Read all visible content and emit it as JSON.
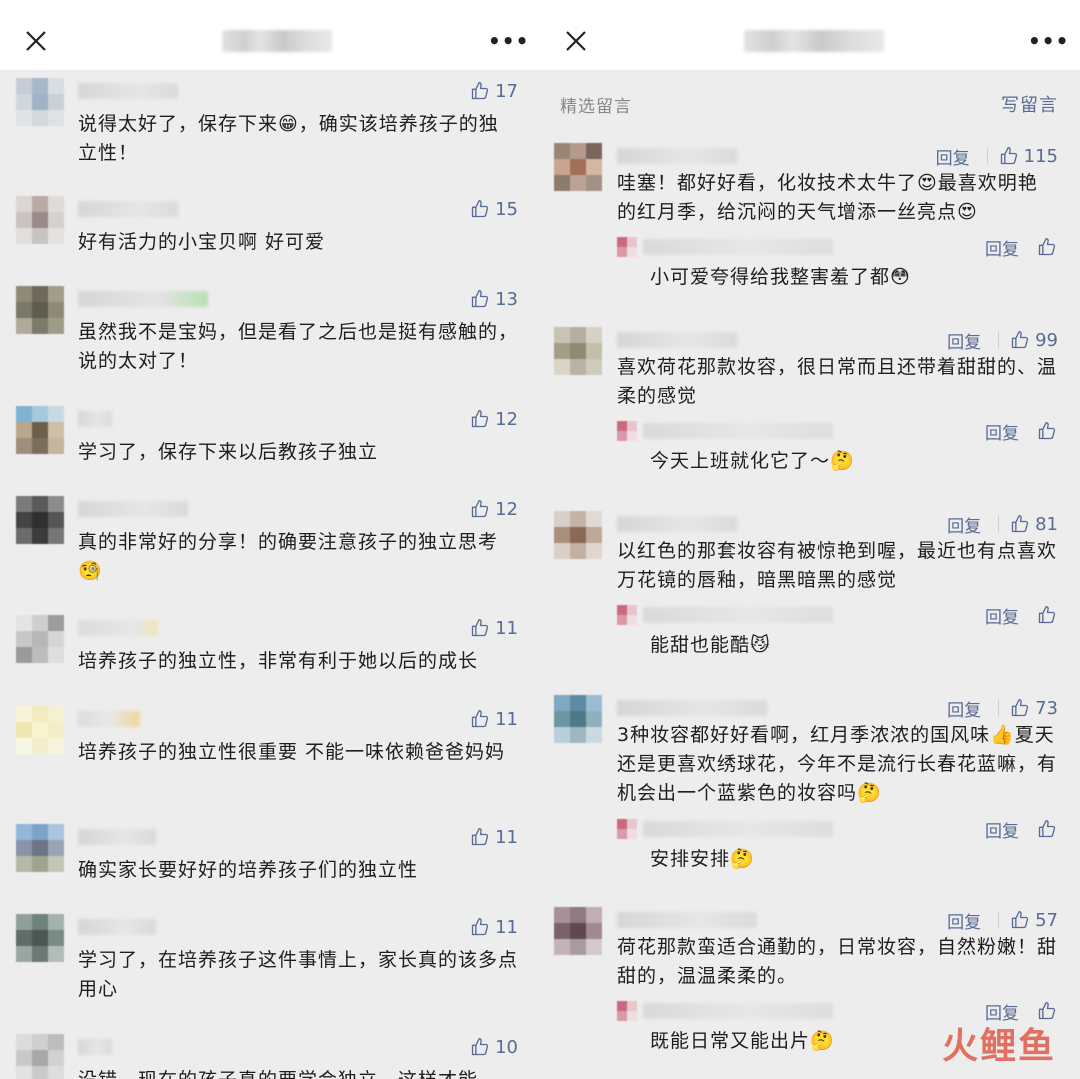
{
  "left": {
    "comments": [
      {
        "likes": "17",
        "text": "说得太好了，保存下来😁，确实该培养孩子的独立性！"
      },
      {
        "likes": "15",
        "text": "好有活力的小宝贝啊 好可爱"
      },
      {
        "likes": "13",
        "text": "虽然我不是宝妈，但是看了之后也是挺有感触的，说的太对了！"
      },
      {
        "likes": "12",
        "text": "学习了，保存下来以后教孩子独立"
      },
      {
        "likes": "12",
        "text": "真的非常好的分享！的确要注意孩子的独立思考🧐"
      },
      {
        "likes": "11",
        "text": "培养孩子的独立性，非常有利于她以后的成长"
      },
      {
        "likes": "11",
        "text": "培养孩子的独立性很重要 不能一味依赖爸爸妈妈"
      },
      {
        "likes": "11",
        "text": "确实家长要好好的培养孩子们的独立性"
      },
      {
        "likes": "11",
        "text": "学习了，在培养孩子这件事情上，家长真的该多点用心"
      },
      {
        "likes": "10",
        "text": "没错，现在的孩子真的要学会独立，这样才能"
      }
    ]
  },
  "right": {
    "section_title": "精选留言",
    "write_label": "写留言",
    "reply_label": "回复",
    "comments": [
      {
        "likes": "115",
        "text": "哇塞！都好好看，化妆技术太牛了😍最喜欢明艳的红月季，给沉闷的天气增添一丝亮点😍",
        "reply": "小可爱夸得给我整害羞了都😳"
      },
      {
        "likes": "99",
        "text": "喜欢荷花那款妆容，很日常而且还带着甜甜的、温柔的感觉",
        "reply": "今天上班就化它了～🤔"
      },
      {
        "likes": "81",
        "text": "以红色的那套妆容有被惊艳到喔，最近也有点喜欢万花镜的唇釉，暗黑暗黑的感觉",
        "reply": "能甜也能酷😼"
      },
      {
        "likes": "73",
        "text": "3种妆容都好好看啊，红月季浓浓的国风味👍夏天还是更喜欢绣球花，今年不是流行长春花蓝嘛，有机会出一个蓝紫色的妆容吗🤔",
        "reply": "安排安排🤔"
      },
      {
        "likes": "57",
        "text": "荷花那款蛮适合通勤的，日常妆容，自然粉嫩！甜甜的，温温柔柔的。",
        "reply": "既能日常又能出片🤔"
      }
    ]
  },
  "watermark": "火鲤鱼",
  "colors": {
    "link": "#576b95",
    "background": "#ededed"
  },
  "icons": [
    "close-icon",
    "more-icon",
    "thumb-up-icon"
  ]
}
